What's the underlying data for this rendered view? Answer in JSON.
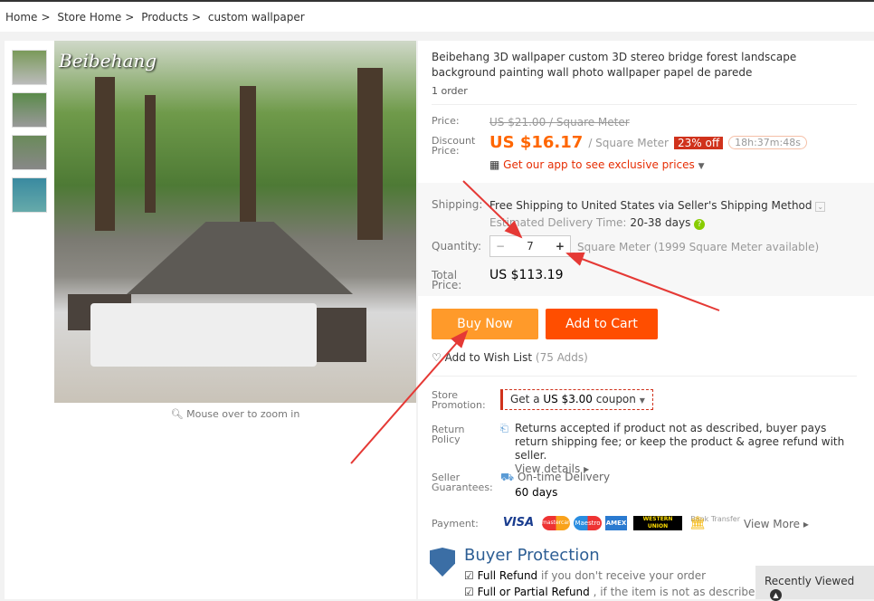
{
  "breadcrumb": [
    "Home",
    ">",
    "Store Home",
    ">",
    "Products",
    ">",
    "custom wallpaper"
  ],
  "gallery": {
    "logo_text": "Beibehang",
    "zoom_hint": "Mouse over to zoom in"
  },
  "product": {
    "title": "Beibehang 3D wallpaper custom 3D stereo bridge forest landscape background painting wall photo wallpaper papel de parede",
    "orders": "1 order",
    "price_label": "Price:",
    "price": "US $21.00 / Square Meter",
    "discount_label_1": "Discount",
    "discount_label_2": "Price:",
    "discount_price": "US $16.17",
    "unit": "/ Square Meter",
    "off": "23% off",
    "timer": "18h:37m:48s",
    "app_promo": "Get our app to see exclusive prices",
    "shipping_label": "Shipping:",
    "shipping_pre": "Free Shipping",
    "shipping_to": " to United States via Seller's Shipping Method",
    "delivery_label": "Estimated Delivery Time:",
    "delivery": "20-38 days",
    "quantity_label": "Quantity:",
    "quantity": "7",
    "available": "Square Meter (1999 Square Meter available)",
    "total_label_1": "Total",
    "total_label_2": "Price:",
    "total": "US $113.19",
    "buy_now": "Buy Now",
    "add_to_cart": "Add to Cart",
    "wishlist": "Add to Wish List",
    "wishlist_count": "(75 Adds)",
    "promo_label_1": "Store",
    "promo_label_2": "Promotion:",
    "coupon_pre": "Get a ",
    "coupon_amount": "US $3.00",
    "coupon_post": " coupon",
    "return_label_1": "Return",
    "return_label_2": "Policy",
    "return_text": "Returns accepted if product not as described, buyer pays return shipping fee; or keep the product & agree refund with seller.",
    "view_details": "View details",
    "guarantee_label_1": "Seller",
    "guarantee_label_2": "Guarantees:",
    "guarantee": "On-time Delivery",
    "guarantee_days": "60 days",
    "payment_label": "Payment:",
    "payments": [
      "VISA",
      "mastercard",
      "Maestro",
      "AMEX",
      "WESTERN UNION",
      "Bank Transfer"
    ],
    "view_more": "View More",
    "protection_title": "Buyer Protection",
    "protection_1_b": "Full Refund",
    "protection_1": " if you don't receive your order",
    "protection_2_b": "Full or Partial Refund",
    "protection_2": " , if the item is not as described"
  },
  "recently_viewed": "Recently Viewed",
  "colors": {
    "accent": "#f60",
    "buy": "#ff9a2a",
    "cart": "#ff4e00",
    "badge": "#d0321c",
    "arrow": "#e53935"
  }
}
